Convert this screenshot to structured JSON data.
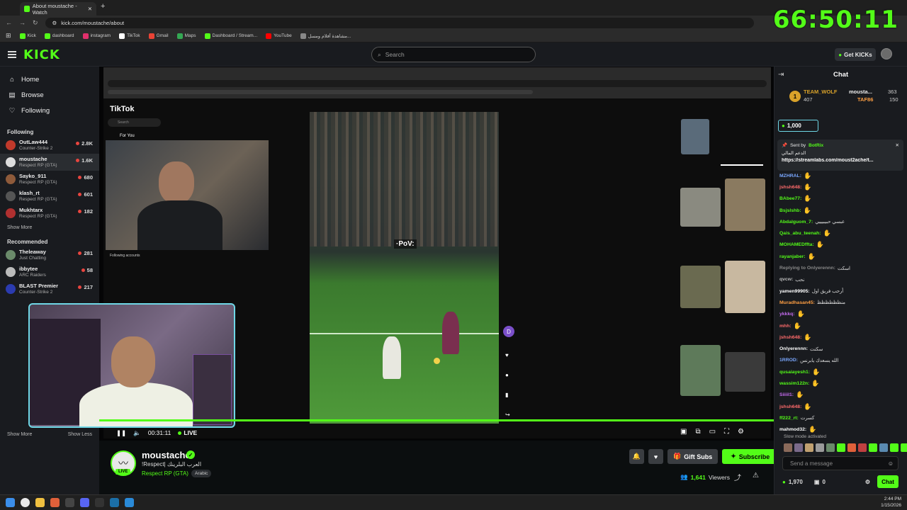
{
  "browser": {
    "tab_title": "About moustache - Watch",
    "url": "kick.com/moustache/about",
    "bookmarks": [
      {
        "label": "Kick",
        "color": "#53fc18"
      },
      {
        "label": "dashboard",
        "color": "#53fc18"
      },
      {
        "label": "instagram",
        "color": "#e1306c"
      },
      {
        "label": "TikTok",
        "color": "#ffffff"
      },
      {
        "label": "Gmail",
        "color": "#ea4335"
      },
      {
        "label": "Maps",
        "color": "#34a853"
      },
      {
        "label": "Dashboard / Stream...",
        "color": "#53fc18"
      },
      {
        "label": "YouTube",
        "color": "#ff0000"
      },
      {
        "label": "مشاهدة أفلام ومسل...",
        "color": "#888888"
      }
    ]
  },
  "stream_timer": "66:50:11",
  "header": {
    "logo": "KICK",
    "search_placeholder": "Search",
    "get_kicks": "Get KICKs"
  },
  "sidebar": {
    "nav": [
      {
        "label": "Home",
        "icon": "home-icon"
      },
      {
        "label": "Browse",
        "icon": "browse-icon"
      },
      {
        "label": "Following",
        "icon": "heart-icon"
      }
    ],
    "following_title": "Following",
    "following": [
      {
        "name": "OutLaw444",
        "category": "Counter-Strike 2",
        "viewers": "2.8K",
        "color": "#c0392b"
      },
      {
        "name": "moustache",
        "category": "Respect RP (GTA)",
        "viewers": "1.6K",
        "color": "#dddddd"
      },
      {
        "name": "Sayko_911",
        "category": "Respect RP (GTA)",
        "viewers": "680",
        "color": "#8e5a3a"
      },
      {
        "name": "klash_rt",
        "category": "Respect RP (GTA)",
        "viewers": "601",
        "color": "#555555"
      },
      {
        "name": "Mukhtarx",
        "category": "Respect RP (GTA)",
        "viewers": "182",
        "color": "#b03030"
      }
    ],
    "show_more": "Show More",
    "recommended_title": "Recommended",
    "recommended": [
      {
        "name": "Theleaway",
        "category": "Just Chatting",
        "viewers": "281",
        "color": "#6a8a6a"
      },
      {
        "name": "ibbytee",
        "category": "ARC Raiders",
        "viewers": "58",
        "color": "#bbbbbb"
      },
      {
        "name": "BLAST Premier",
        "category": "Counter-Strike 2",
        "viewers": "217",
        "color": "#2b3bb0"
      }
    ],
    "show_more_2": "Show More",
    "show_less": "Show Less"
  },
  "video": {
    "tiktok_logo": "TikTok",
    "tiktok_search": "Search",
    "for_you": "For You",
    "following_accounts": "Following accounts",
    "pov_text": "·PoV:",
    "time": "00:31:11",
    "live_label": "LIVE"
  },
  "channel": {
    "name": "moustache",
    "title": "!Respect| العرب البلرينك",
    "category": "Respect RP (GTA)",
    "language": "Arabic",
    "live_badge": "LIVE",
    "gift_subs": "Gift Subs",
    "subscribe": "Subscribe",
    "viewers": "1,641",
    "viewers_label": "Viewers"
  },
  "chat": {
    "title": "Chat",
    "leaderboard": [
      {
        "name": "TEAM_WOLF",
        "value": "407"
      },
      {
        "name": "mousta...",
        "value": "363"
      },
      {
        "name": "TAF86",
        "value": "150"
      }
    ],
    "pinned_amount": "1,000",
    "pinned_sent_by": "Sent by",
    "pinned_bot": "BotRix",
    "pinned_text": "الدعم المالي",
    "pinned_link": "https://streamlabs.com/moust2ache/t...",
    "messages": [
      {
        "user": "MZHRAL:",
        "text": "",
        "color": "#7aa7ff"
      },
      {
        "user": "jshsh648:",
        "text": "",
        "color": "#ff6b6b"
      },
      {
        "user": "BAbee77:",
        "text": "",
        "color": "#53fc18"
      },
      {
        "user": "Bsjslshb:",
        "text": "",
        "color": "#53fc18"
      },
      {
        "user": "Abdalguom_7:",
        "text": "عبسي حبيبيييي",
        "color": "#53fc18"
      },
      {
        "user": "Qais_abu_teenah:",
        "text": "",
        "color": "#53fc18"
      },
      {
        "user": "MOHAMEDffta:",
        "text": "",
        "color": "#53fc18"
      },
      {
        "user": "rayanjaber:",
        "text": "",
        "color": "#53fc18"
      },
      {
        "user": "Replying to Onlyerennn:",
        "text": "اسكت",
        "color": "#888888"
      },
      {
        "user": "qvcw:",
        "text": "نحب",
        "color": "#bbbbbb"
      },
      {
        "user": "yamen99905:",
        "text": "أرحب فريق اول",
        "color": "#ffffff"
      },
      {
        "user": "Muradhasan45:",
        "text": "منظظظظظظ",
        "color": "#ff9f43"
      },
      {
        "user": "ykkkq:",
        "text": "",
        "color": "#c56cf0"
      },
      {
        "user": "mhh:",
        "text": "",
        "color": "#ff6b6b"
      },
      {
        "user": "jshsh648:",
        "text": "",
        "color": "#ff6b6b"
      },
      {
        "user": "Onlyerennn:",
        "text": "سكتت",
        "color": "#ffffff"
      },
      {
        "user": "1RROD:",
        "text": "الله يسعدك يابرنس",
        "color": "#7aa7ff"
      },
      {
        "user": "qusaiayesh1:",
        "text": "",
        "color": "#53fc18"
      },
      {
        "user": "wassim122n:",
        "text": "",
        "color": "#53fc18"
      },
      {
        "user": "Siiiil1:",
        "text": "",
        "color": "#c56cf0"
      },
      {
        "user": "jshsh648:",
        "text": "",
        "color": "#ff6b6b"
      },
      {
        "user": "ff222_rt:",
        "text": "كسرت",
        "color": "#53fc18"
      },
      {
        "user": "mahmod32:",
        "text": "",
        "color": "#ffffff"
      }
    ],
    "slow_mode": "Slow mode activated",
    "send_placeholder": "Send a message",
    "kicks_count": "1,970",
    "box_count": "0",
    "chat_button": "Chat"
  },
  "taskbar": {
    "time": "2:44 PM",
    "date": "1/15/2026"
  }
}
